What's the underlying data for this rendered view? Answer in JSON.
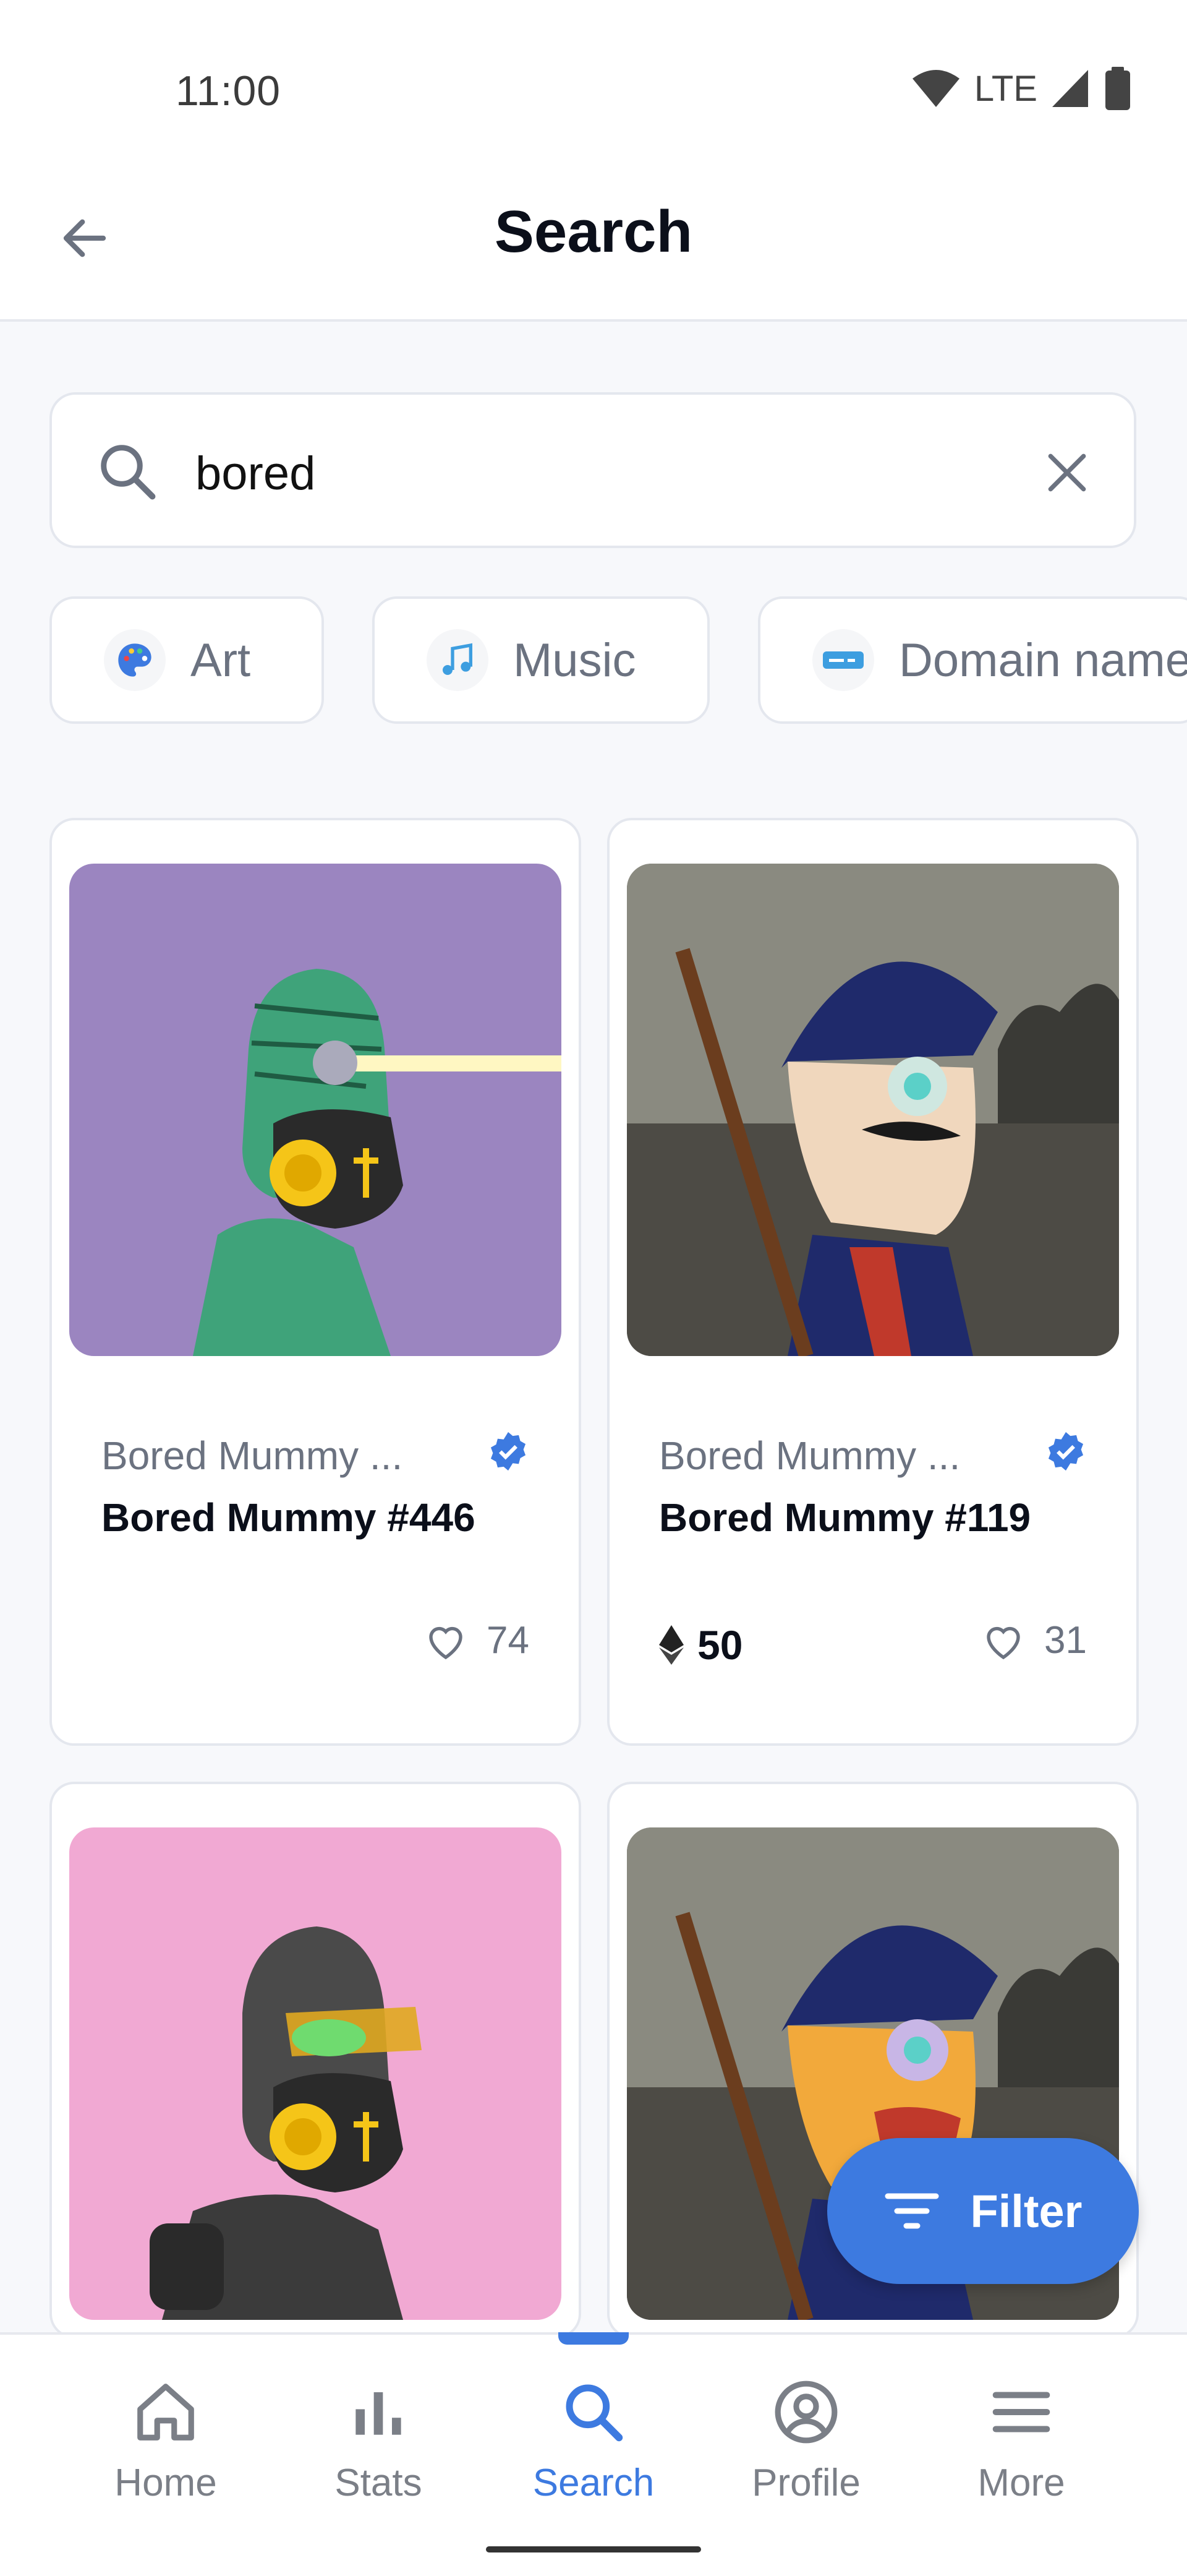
{
  "status_bar": {
    "time": "11:00",
    "network": "LTE"
  },
  "header": {
    "title": "Search",
    "back_icon": "arrow-left-icon"
  },
  "search": {
    "value": "bored",
    "placeholder": "Search",
    "icon": "search-icon",
    "clear_icon": "close-icon"
  },
  "categories": [
    {
      "label": "Art",
      "icon": "palette-icon"
    },
    {
      "label": "Music",
      "icon": "music-notes-icon"
    },
    {
      "label": "Domain names",
      "icon": "domain-icon"
    }
  ],
  "results": [
    {
      "collection": "Bored Mummy ...",
      "name": "Bored Mummy #446",
      "price": "",
      "likes": "74",
      "verified": true,
      "bg": "#9b85c0"
    },
    {
      "collection": "Bored Mummy ...",
      "name": "Bored Mummy #119",
      "price": "50",
      "likes": "31",
      "verified": true,
      "bg": "#6f6f68"
    },
    {
      "collection": "",
      "name": "",
      "price": "",
      "likes": "",
      "verified": false,
      "bg": "#f1a9d3"
    },
    {
      "collection": "",
      "name": "",
      "price": "",
      "likes": "",
      "verified": false,
      "bg": "#6f6f68"
    }
  ],
  "filter_button": {
    "label": "Filter"
  },
  "bottom_nav": [
    {
      "label": "Home",
      "icon": "home-icon"
    },
    {
      "label": "Stats",
      "icon": "bar-chart-icon"
    },
    {
      "label": "Search",
      "icon": "search-icon",
      "active": true
    },
    {
      "label": "Profile",
      "icon": "user-circle-icon"
    },
    {
      "label": "More",
      "icon": "menu-icon"
    }
  ],
  "colors": {
    "accent": "#3d7ae0",
    "text": "#0b0f1a",
    "muted": "#6b7280",
    "border": "#e4e7ee",
    "background": "#f7f8fb"
  }
}
